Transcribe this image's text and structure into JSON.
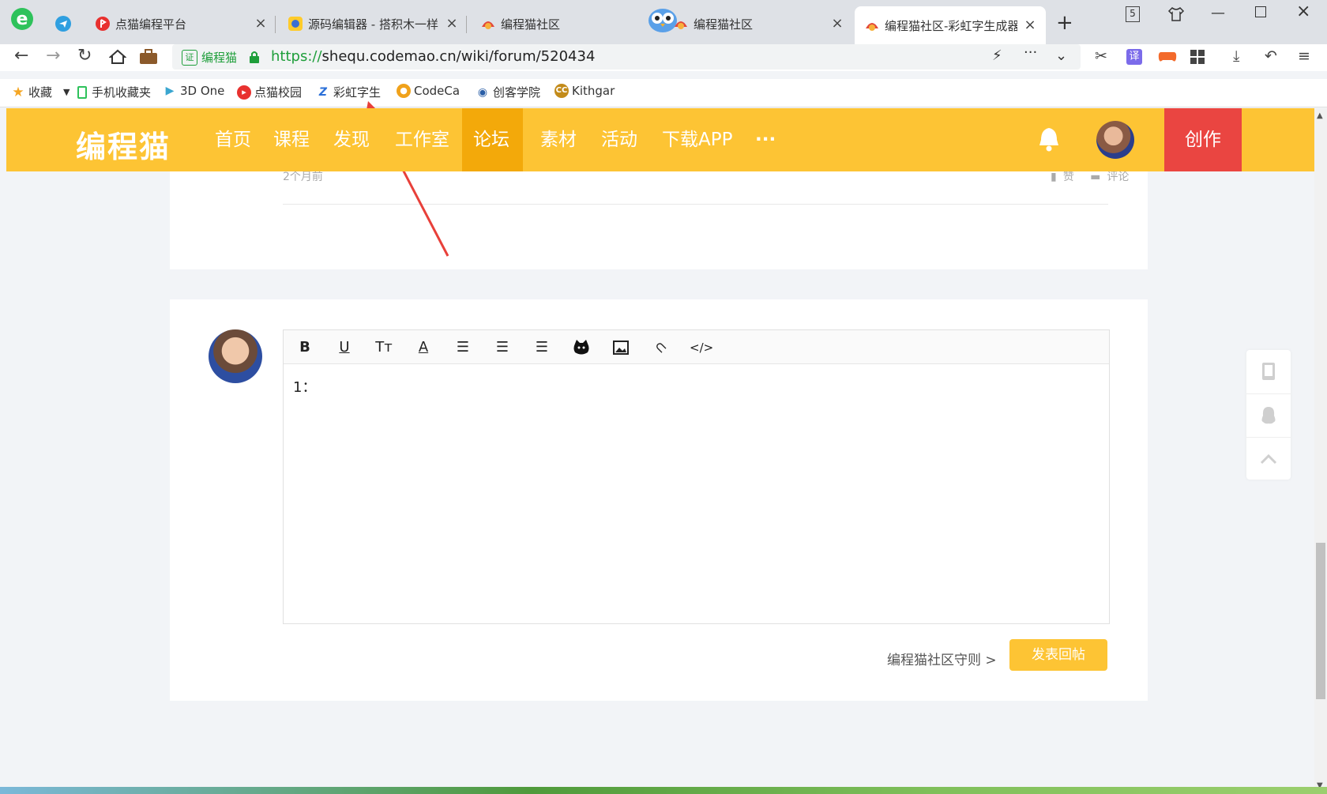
{
  "browser": {
    "tabs": [
      {
        "label": "点猫编程平台"
      },
      {
        "label": "源码编辑器 - 搭积木一样"
      },
      {
        "label": "编程猫社区"
      },
      {
        "label": "编程猫社区"
      },
      {
        "label": "编程猫社区-彩虹字生成器"
      }
    ],
    "tab_count_badge": "5"
  },
  "address_bar": {
    "site_badge": "编程猫",
    "url_scheme": "https://",
    "url_rest": "shequ.codemao.cn/wiki/forum/520434"
  },
  "bookmarks": [
    {
      "label": "收藏"
    },
    {
      "label": "手机收藏夹"
    },
    {
      "label": "3D One"
    },
    {
      "label": "点猫校园"
    },
    {
      "label": "彩虹字生"
    },
    {
      "label": "CodeCa"
    },
    {
      "label": "创客学院"
    },
    {
      "label": "Kithgar"
    }
  ],
  "site": {
    "logo": "编程猫",
    "nav": [
      "首页",
      "课程",
      "发现",
      "工作室",
      "论坛",
      "素材",
      "活动",
      "下载APP",
      "···"
    ],
    "create_label": "创作"
  },
  "post": {
    "time": "2个月前",
    "like_label": "赞",
    "comment_label": "评论"
  },
  "editor": {
    "content": "1：",
    "rules_link": "编程猫社区守则 >",
    "submit_label": "发表回帖"
  },
  "colors": {
    "brand_yellow": "#fdc434",
    "nav_active": "#f3a90a",
    "create_red": "#ea4541",
    "annotation_arrow": "#e8403a"
  }
}
